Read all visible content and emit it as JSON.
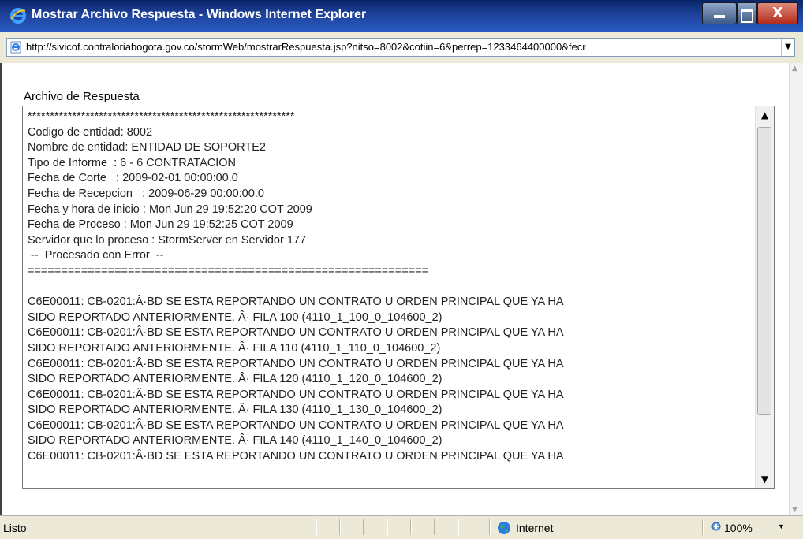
{
  "window": {
    "title": "Mostrar Archivo Respuesta - Windows Internet Explorer",
    "minimize_icon": "minimize-icon",
    "maximize_icon": "maximize-icon",
    "close_icon": "close-icon",
    "close_glyph": "X"
  },
  "address_bar": {
    "url": "http://sivicof.contraloriabogota.gov.co/stormWeb/mostrarRespuesta.jsp?nitso=8002&cotiin=6&perrep=1233464400000&fecr",
    "dropdown_glyph": "▼"
  },
  "content": {
    "label": "Archivo de Respuesta",
    "lines": [
      "************************************************************",
      "Codigo de entidad: 8002",
      "Nombre de entidad: ENTIDAD DE SOPORTE2",
      "Tipo de Informe  : 6 - 6 CONTRATACION",
      "Fecha de Corte   : 2009-02-01 00:00:00.0",
      "Fecha de Recepcion   : 2009-06-29 00:00:00.0",
      "Fecha y hora de inicio : Mon Jun 29 19:52:20 COT 2009",
      "Fecha de Proceso : Mon Jun 29 19:52:25 COT 2009",
      "Servidor que lo proceso : StormServer en Servidor 177",
      " --  Procesado con Error  --",
      "============================================================",
      "",
      "C6E00011: CB-0201:Â·BD SE ESTA REPORTANDO UN CONTRATO U ORDEN PRINCIPAL QUE YA HA",
      "SIDO REPORTADO ANTERIORMENTE. Â· FILA 100 (4110_1_100_0_104600_2)",
      "C6E00011: CB-0201:Â·BD SE ESTA REPORTANDO UN CONTRATO U ORDEN PRINCIPAL QUE YA HA",
      "SIDO REPORTADO ANTERIORMENTE. Â· FILA 110 (4110_1_110_0_104600_2)",
      "C6E00011: CB-0201:Â·BD SE ESTA REPORTANDO UN CONTRATO U ORDEN PRINCIPAL QUE YA HA",
      "SIDO REPORTADO ANTERIORMENTE. Â· FILA 120 (4110_1_120_0_104600_2)",
      "C6E00011: CB-0201:Â·BD SE ESTA REPORTANDO UN CONTRATO U ORDEN PRINCIPAL QUE YA HA",
      "SIDO REPORTADO ANTERIORMENTE. Â· FILA 130 (4110_1_130_0_104600_2)",
      "C6E00011: CB-0201:Â·BD SE ESTA REPORTANDO UN CONTRATO U ORDEN PRINCIPAL QUE YA HA",
      "SIDO REPORTADO ANTERIORMENTE. Â· FILA 140 (4110_1_140_0_104600_2)",
      "C6E00011: CB-0201:Â·BD SE ESTA REPORTANDO UN CONTRATO U ORDEN PRINCIPAL QUE YA HA"
    ],
    "scroll_up_glyph": "▲",
    "scroll_down_glyph": "▼"
  },
  "status_bar": {
    "status": "Listo",
    "zone": "Internet",
    "zoom": "100%",
    "zoom_arrow_glyph": "▼"
  },
  "colors": {
    "titlebar": "#0a246a",
    "chrome": "#ece9d8",
    "close_button": "#b32b1a"
  }
}
